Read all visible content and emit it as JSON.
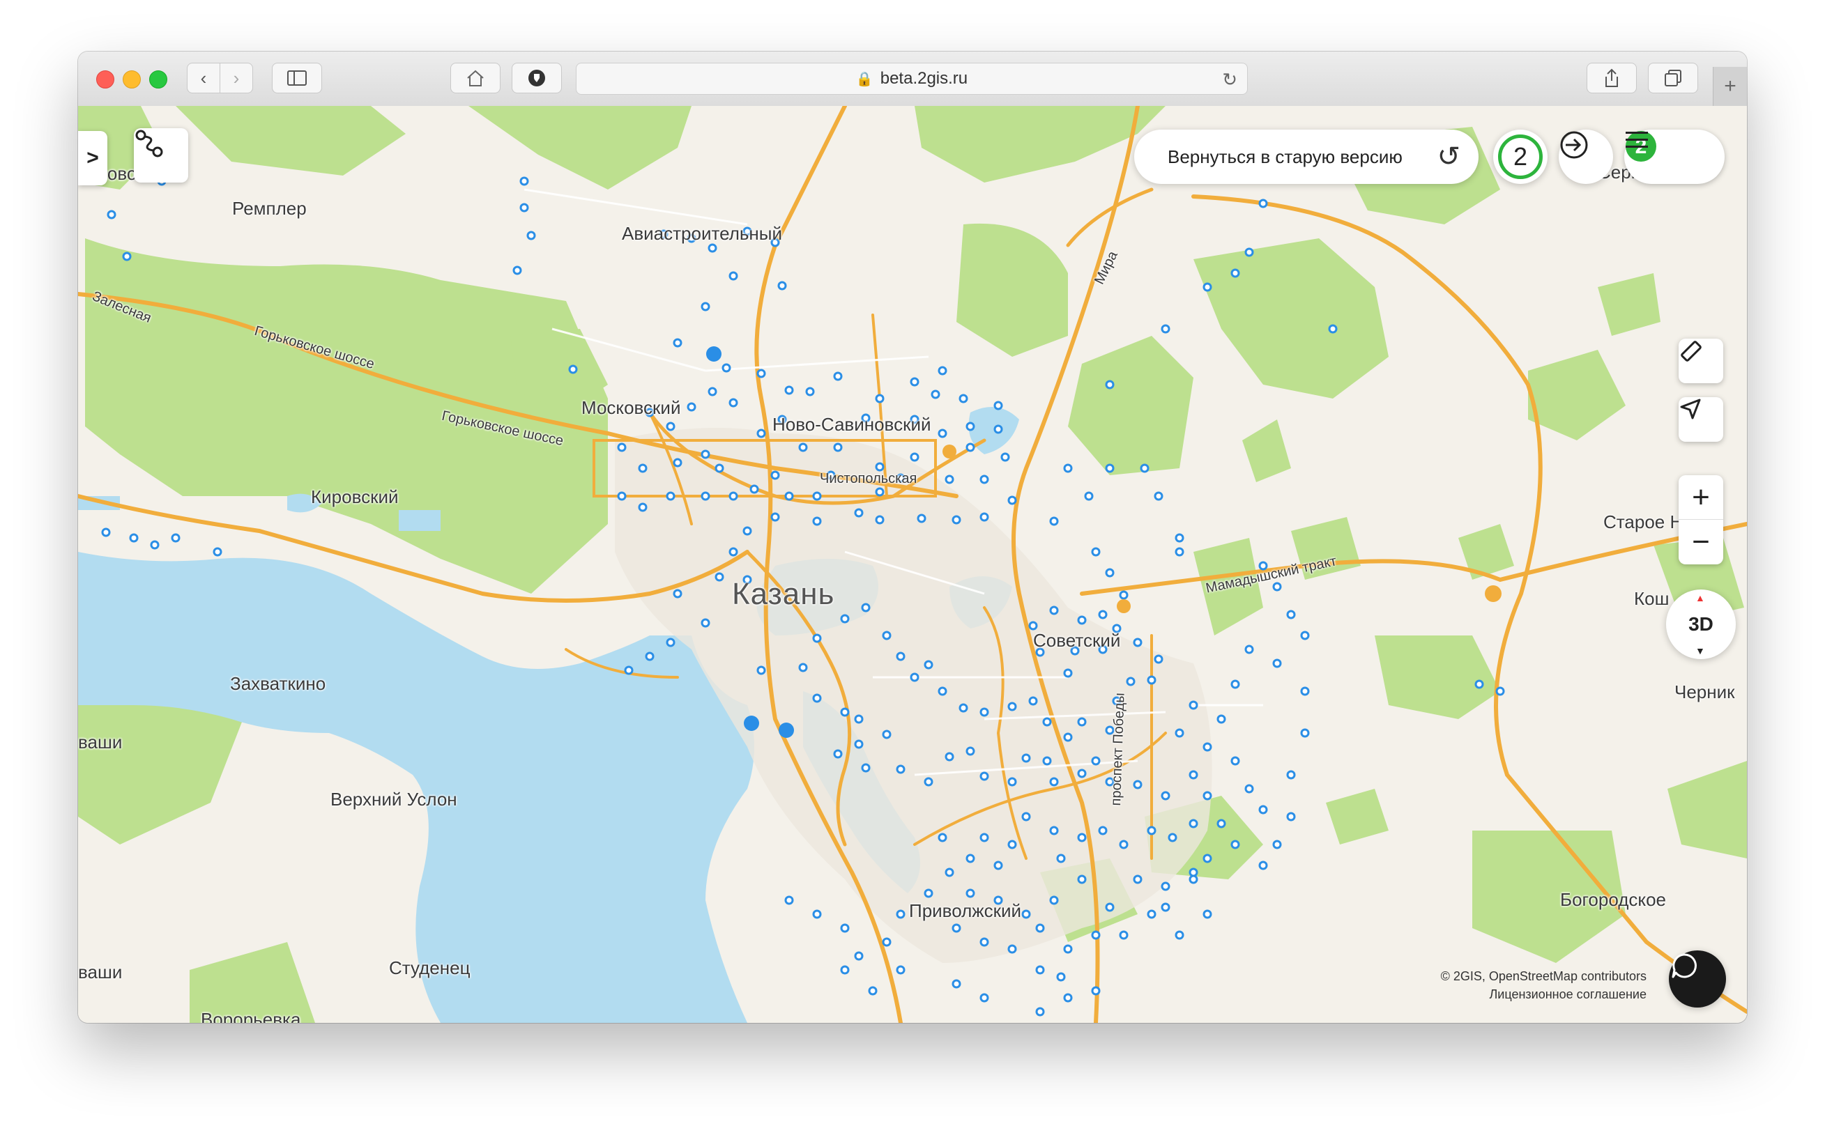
{
  "browser": {
    "url": "beta.2gis.ru",
    "new_tab_label": "+"
  },
  "map_controls": {
    "back_to_old_version": "Вернуться в старую версию",
    "notifications_count": "2",
    "zoom_in": "+",
    "zoom_out": "−",
    "view_3d": "3D",
    "expand_panel": ">"
  },
  "map": {
    "city": "Казань",
    "places": [
      {
        "name": "Ремплер"
      },
      {
        "name": "Авиастроительный"
      },
      {
        "name": "Московский"
      },
      {
        "name": "Ново-Савиновский"
      },
      {
        "name": "Чистопольская"
      },
      {
        "name": "Кировский"
      },
      {
        "name": "Советский"
      },
      {
        "name": "Захваткино"
      },
      {
        "name": "Верхний Услон"
      },
      {
        "name": "Студенец"
      },
      {
        "name": "Приволжский"
      },
      {
        "name": "Богородское"
      },
      {
        "name": "Старое Н"
      },
      {
        "name": "Кош"
      },
      {
        "name": "Черник"
      },
      {
        "name": "Ворорьевка"
      },
      {
        "name": "ваши"
      },
      {
        "name": "ваши"
      },
      {
        "name": "синово"
      },
      {
        "name": "Серм"
      }
    ],
    "roads": [
      {
        "name": "Залесная"
      },
      {
        "name": "Горьковское шоссе"
      },
      {
        "name": "Горьковское шоссе"
      },
      {
        "name": "Мамадышский тракт"
      },
      {
        "name": "проспект Победы"
      },
      {
        "name": "Мира"
      }
    ],
    "attribution": "© 2GIS, OpenStreetMap contributors",
    "license": "Лицензионное соглашение"
  },
  "colors": {
    "water": "#b2dcf0",
    "forest": "#bde08f",
    "road": "#f1ad3c",
    "brand_green": "#2db43c",
    "marker": "#2a8ee6"
  }
}
